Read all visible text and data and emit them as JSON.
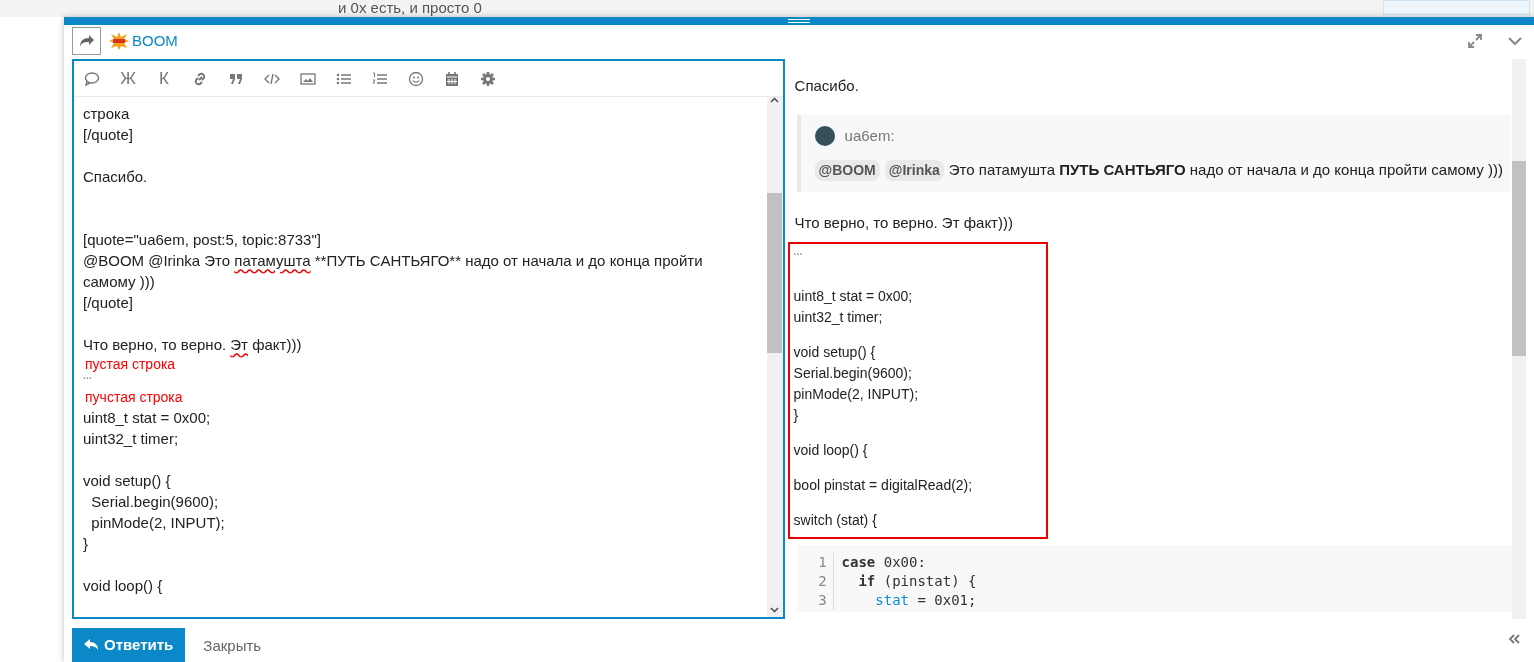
{
  "background_topic": {
    "text": "и 0x есть, и просто 0"
  },
  "composer": {
    "reply_to": {
      "name": "BOOM"
    },
    "toolbar": [
      {
        "kind": "icon"
      },
      {
        "kind": "text",
        "label": "Ж"
      },
      {
        "kind": "text",
        "label": "К"
      },
      {
        "kind": "icon"
      },
      {
        "kind": "icon"
      },
      {
        "kind": "icon"
      },
      {
        "kind": "icon"
      },
      {
        "kind": "icon"
      },
      {
        "kind": "icon"
      },
      {
        "kind": "icon"
      },
      {
        "kind": "icon"
      },
      {
        "kind": "icon"
      }
    ],
    "editor_lines": [
      {
        "kind": "text",
        "segments": [
          {
            "text": "строка",
            "misspelled": false
          }
        ]
      },
      {
        "kind": "text",
        "segments": [
          {
            "text": "[/quote]",
            "misspelled": false
          }
        ]
      },
      {
        "kind": "blank"
      },
      {
        "kind": "text",
        "segments": [
          {
            "text": "Спасибо.",
            "misspelled": false
          }
        ]
      },
      {
        "kind": "blank"
      },
      {
        "kind": "blank"
      },
      {
        "kind": "text",
        "segments": [
          {
            "text": "[quote=\"ua6em, post:5, topic:8733\"]",
            "misspelled": false
          }
        ]
      },
      {
        "kind": "text",
        "segments": [
          {
            "text": "@BOOM @Irinka Это ",
            "misspelled": false
          },
          {
            "text": "патамушта",
            "misspelled": true
          },
          {
            "text": " **ПУТЬ САНТЬЯГО** надо от начала и до конца пройти самому )))",
            "misspelled": false
          }
        ]
      },
      {
        "kind": "text",
        "segments": [
          {
            "text": "[/quote]",
            "misspelled": false
          }
        ]
      },
      {
        "kind": "blank"
      },
      {
        "kind": "text",
        "segments": [
          {
            "text": "Что верно, то верно. ",
            "misspelled": false
          },
          {
            "text": "Эт",
            "misspelled": true
          },
          {
            "text": " факт)))",
            "misspelled": false
          }
        ]
      },
      {
        "kind": "annotation",
        "text": "пустая строка"
      },
      {
        "kind": "fence",
        "text": "```"
      },
      {
        "kind": "annotation",
        "text": "пучстая строка"
      },
      {
        "kind": "text",
        "segments": [
          {
            "text": "uint8_t stat = 0x00;",
            "misspelled": false
          }
        ]
      },
      {
        "kind": "text",
        "segments": [
          {
            "text": "uint32_t timer;",
            "misspelled": false
          }
        ]
      },
      {
        "kind": "blank"
      },
      {
        "kind": "text",
        "segments": [
          {
            "text": "void setup() {",
            "misspelled": false
          }
        ]
      },
      {
        "kind": "text",
        "segments": [
          {
            "text": "  Serial.begin(9600);",
            "misspelled": false
          }
        ]
      },
      {
        "kind": "text",
        "segments": [
          {
            "text": "  pinMode(2, INPUT);",
            "misspelled": false
          }
        ]
      },
      {
        "kind": "text",
        "segments": [
          {
            "text": "}",
            "misspelled": false
          }
        ]
      },
      {
        "kind": "blank"
      },
      {
        "kind": "text",
        "segments": [
          {
            "text": "void loop() {",
            "misspelled": false
          }
        ]
      }
    ],
    "preview": {
      "intro": "Спасибо.",
      "quote": {
        "author": "ua6em:",
        "mentions": [
          "@BOOM",
          "@Irinka"
        ],
        "text": "Это патамушта **ПУТЬ САНТЬЯГО** надо от начала и до конца пройти самому )))"
      },
      "after_quote": "Что верно, то верно. Эт факт)))",
      "highlighted_paragraphs": [
        [
          "```"
        ],
        [
          "uint8_t stat = 0x00;",
          "uint32_t timer;"
        ],
        [
          "void setup() {",
          "Serial.begin(9600);",
          "pinMode(2, INPUT);",
          "}"
        ],
        [
          "void loop() {"
        ],
        [
          "bool pinstat = digitalRead(2);"
        ],
        [
          "switch (stat) {"
        ]
      ],
      "code_lines": [
        {
          "number": "1",
          "tokens": [
            {
              "kind": "keyword",
              "text": "case"
            },
            {
              "kind": "plain",
              "text": " 0x00:"
            }
          ]
        },
        {
          "number": "2",
          "tokens": [
            {
              "kind": "keyword",
              "text": "  if"
            },
            {
              "kind": "plain",
              "text": " (pinstat) {"
            }
          ]
        },
        {
          "number": "3",
          "tokens": [
            {
              "kind": "variable",
              "text": "    stat"
            },
            {
              "kind": "plain",
              "text": " = 0x01;"
            }
          ]
        }
      ]
    },
    "buttons": {
      "reply": "Ответить",
      "close": "Закрыть"
    }
  }
}
